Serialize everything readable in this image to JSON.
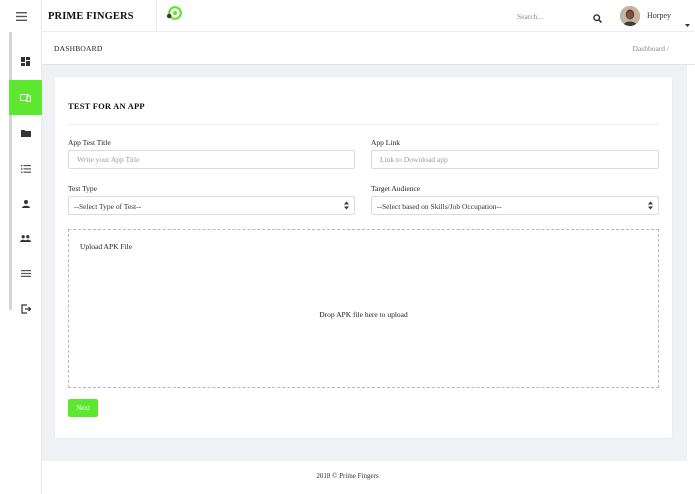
{
  "topbar": {
    "brand": "PRIME FINGERS",
    "search_placeholder": "Search...",
    "user_name": "Horpey"
  },
  "breadcrumb": {
    "title": "DASHBOARD",
    "trail": "Dashboard /"
  },
  "sidebar": {
    "items": [
      {
        "icon": "dashboard-icon"
      },
      {
        "icon": "device-icon",
        "active": true
      },
      {
        "icon": "folder-icon"
      },
      {
        "icon": "list-icon"
      },
      {
        "icon": "user-icon"
      },
      {
        "icon": "users-icon"
      },
      {
        "icon": "menu-icon"
      },
      {
        "icon": "logout-icon"
      }
    ]
  },
  "form": {
    "title": "TEST FOR AN APP",
    "app_title_label": "App Test Title",
    "app_title_placeholder": "Write your App Title",
    "app_link_label": "App Link",
    "app_link_placeholder": "Link to Download app",
    "test_type_label": "Test Type",
    "test_type_value": "--Select Type of Test--",
    "audience_label": "Target Audience",
    "audience_value": "--Select based on Skills/Job Occupation--",
    "upload_label": "Upload APK File",
    "dropzone_message": "Drop APK file here to upload",
    "next_label": "Next"
  },
  "footer": {
    "text": "2018 © Prime Fingers"
  },
  "colors": {
    "accent": "#5ce82e",
    "background": "#eff1f4"
  }
}
